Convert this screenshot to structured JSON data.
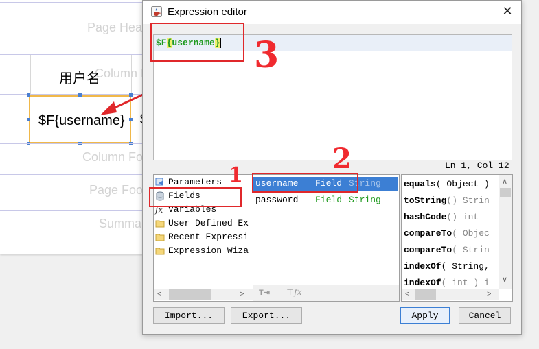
{
  "designer": {
    "bands": [
      "Page Hea",
      "Column He",
      "Column Fo",
      "Page Foo",
      "Summa"
    ],
    "column_header_text": "用户名",
    "field_text": "$F{username}",
    "field_text_clip": "S"
  },
  "dialog": {
    "title": "Expression editor",
    "expression": {
      "prefix": "$F",
      "open_brace": "{",
      "name": "username",
      "close_brace": "}"
    },
    "cursor_position": "Ln 1, Col 12",
    "categories": [
      "Parameters",
      "Fields",
      "Variables",
      "User Defined Ex",
      "Recent Expressi",
      "Expression Wiza"
    ],
    "fields": [
      {
        "name": "username",
        "kind": "Field",
        "type": "String",
        "selected": true
      },
      {
        "name": "password",
        "kind": "Field",
        "type": "String",
        "selected": false
      }
    ],
    "methods": [
      {
        "name": "equals",
        "args": "( Object )"
      },
      {
        "name": "toString",
        "args": "() Strin"
      },
      {
        "name": "hashCode",
        "args": "() int"
      },
      {
        "name": "compareTo",
        "args": "( Objec"
      },
      {
        "name": "compareTo",
        "args": "( Strin"
      },
      {
        "name": "indexOf",
        "args": "( String,"
      },
      {
        "name": "indexOf",
        "args": "( int ) i"
      }
    ],
    "buttons": {
      "import": "Import...",
      "export": "Export...",
      "apply": "Apply",
      "cancel": "Cancel"
    }
  },
  "annotations": {
    "n1": "1",
    "n2": "2",
    "n3": "3"
  },
  "colors": {
    "selection": "#3c7fd4",
    "green": "#1f9a1f",
    "annotation": "#e0282b"
  }
}
